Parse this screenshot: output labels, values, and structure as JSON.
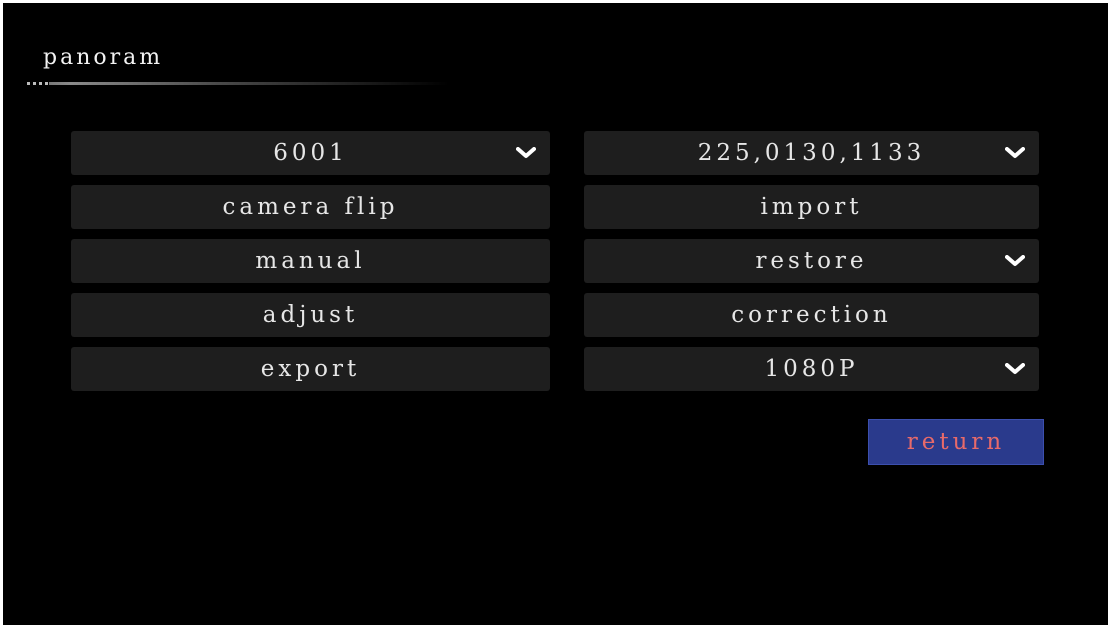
{
  "window": {
    "title": "panoram"
  },
  "left_column": [
    {
      "label": "6001",
      "has_dropdown": true
    },
    {
      "label": "camera flip",
      "has_dropdown": false
    },
    {
      "label": "manual",
      "has_dropdown": false
    },
    {
      "label": "adjust",
      "has_dropdown": false
    },
    {
      "label": "export",
      "has_dropdown": false
    }
  ],
  "right_column": [
    {
      "label": "225,0130,1133",
      "has_dropdown": true
    },
    {
      "label": "import",
      "has_dropdown": false
    },
    {
      "label": "restore",
      "has_dropdown": true
    },
    {
      "label": "correction",
      "has_dropdown": false
    },
    {
      "label": "1080P",
      "has_dropdown": true
    }
  ],
  "footer": {
    "return_label": "return"
  },
  "colors": {
    "background": "#000000",
    "button_bg": "#1e1e1e",
    "button_text": "#e6e6e6",
    "return_bg": "#2a3a8c",
    "return_text": "#e86a6a"
  },
  "icons": {
    "dropdown": "chevron-down-icon"
  }
}
